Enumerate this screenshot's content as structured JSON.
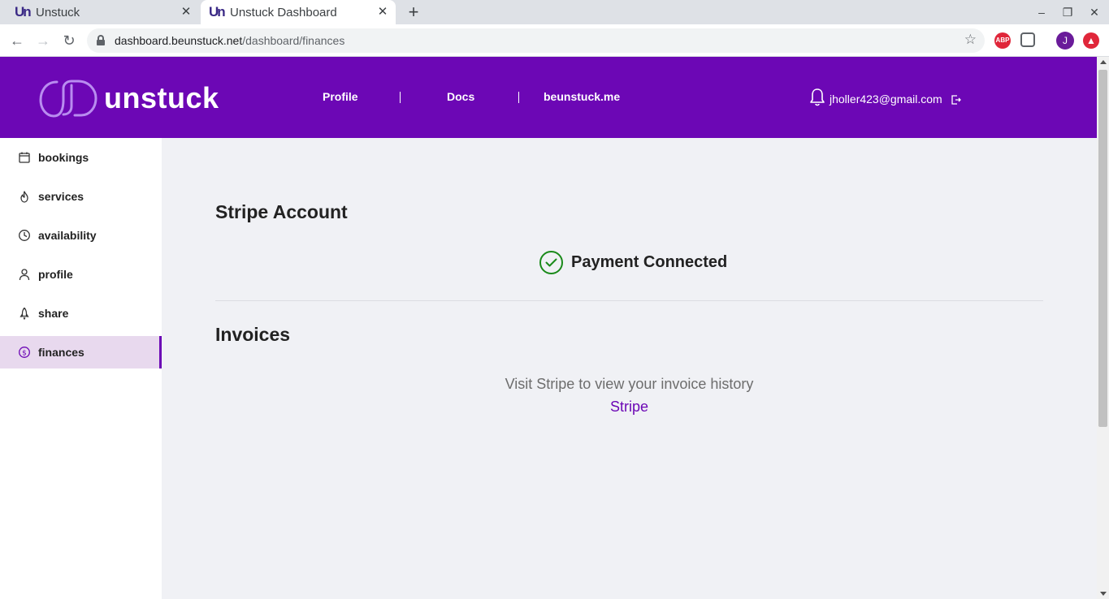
{
  "browser": {
    "tabs": [
      {
        "title": "Unstuck",
        "favicon": "Un",
        "active": false
      },
      {
        "title": "Unstuck Dashboard",
        "favicon": "Un",
        "active": true
      }
    ],
    "new_tab_icon": "plus-icon",
    "address": {
      "host": "dashboard.beunstuck.net",
      "path": "/dashboard/finances"
    },
    "extensions": [
      {
        "name": "adblock-plus-icon",
        "label": "ABP",
        "color": "#e0263a"
      },
      {
        "name": "extension-icon",
        "label": "",
        "color": "#5f6368"
      }
    ],
    "profile_initial": "J",
    "profile_color": "#6a1b9a"
  },
  "header": {
    "logo_text": "unstuck",
    "nav": [
      {
        "label": "Profile"
      },
      {
        "label": "Docs"
      },
      {
        "label": "beunstuck.me"
      }
    ],
    "user_email": "jholler423@gmail.com",
    "brand_color": "#6c07b5"
  },
  "sidebar": {
    "items": [
      {
        "label": "bookings",
        "icon": "calendar-icon",
        "active": false
      },
      {
        "label": "services",
        "icon": "flame-icon",
        "active": false
      },
      {
        "label": "availability",
        "icon": "clock-icon",
        "active": false
      },
      {
        "label": "profile",
        "icon": "user-icon",
        "active": false
      },
      {
        "label": "share",
        "icon": "rocket-icon",
        "active": false
      },
      {
        "label": "finances",
        "icon": "dollar-circle-icon",
        "active": true
      }
    ]
  },
  "main": {
    "stripe_heading": "Stripe Account",
    "payment_status": "Payment Connected",
    "status_color": "#1a8a1a",
    "invoices_heading": "Invoices",
    "invoice_note": "Visit Stripe to view your invoice history",
    "stripe_link": "Stripe"
  }
}
